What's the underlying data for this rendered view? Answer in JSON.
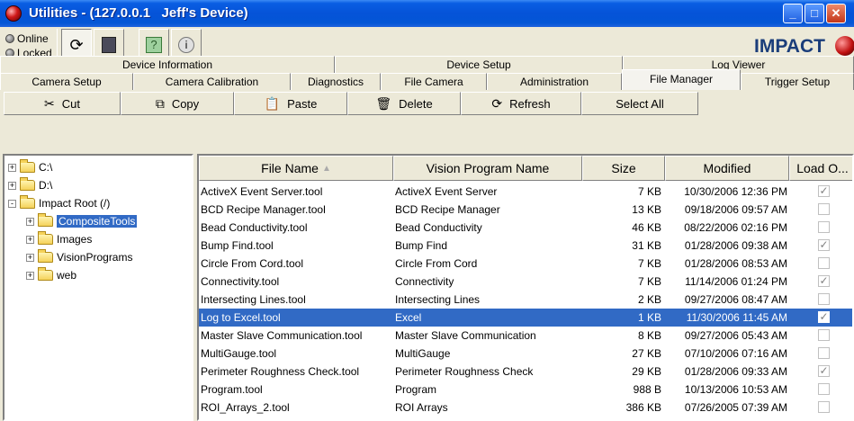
{
  "window": {
    "title": "Utilities - (127.0.0.1   Jeff's Device)",
    "controls": [
      "minimize",
      "maximize",
      "close"
    ]
  },
  "status": {
    "online_label": "Online",
    "locked_label": "Locked"
  },
  "toolbar": {
    "icons": [
      "refresh-sync-icon",
      "device-icon",
      "help-icon",
      "info-icon"
    ],
    "logo_text": "IMPACT"
  },
  "tabs": {
    "back_row": [
      "Device Information",
      "Device Setup",
      "Log Viewer"
    ],
    "front_row": [
      "Camera Setup",
      "Camera Calibration",
      "Diagnostics",
      "File Camera",
      "Administration",
      "File Manager",
      "Trigger Setup"
    ],
    "active": "File Manager"
  },
  "actions": {
    "cut": "Cut",
    "copy": "Copy",
    "paste": "Paste",
    "delete": "Delete",
    "refresh": "Refresh",
    "select_all": "Select All"
  },
  "tree": {
    "items": [
      {
        "label": "C:\\",
        "level": 0,
        "expander": "+"
      },
      {
        "label": "D:\\",
        "level": 0,
        "expander": "+"
      },
      {
        "label": "Impact Root (/)",
        "level": 0,
        "expander": "-"
      },
      {
        "label": "CompositeTools",
        "level": 1,
        "expander": "+",
        "selected": true
      },
      {
        "label": "Images",
        "level": 1,
        "expander": "+"
      },
      {
        "label": "VisionPrograms",
        "level": 1,
        "expander": "+"
      },
      {
        "label": "web",
        "level": 1,
        "expander": "+"
      }
    ]
  },
  "table": {
    "columns": [
      "File Name",
      "Vision Program Name",
      "Size",
      "Modified",
      "Load O..."
    ],
    "sort_column": "File Name",
    "rows": [
      {
        "file": "ActiveX Event Server.tool",
        "program": "ActiveX Event Server",
        "size": "7 KB",
        "modified": "10/30/2006 12:36 PM",
        "load": true
      },
      {
        "file": "BCD Recipe Manager.tool",
        "program": "BCD Recipe Manager",
        "size": "13 KB",
        "modified": "09/18/2006 09:57 AM",
        "load": false
      },
      {
        "file": "Bead Conductivity.tool",
        "program": "Bead Conductivity",
        "size": "46 KB",
        "modified": "08/22/2006 02:16 PM",
        "load": false
      },
      {
        "file": "Bump Find.tool",
        "program": "Bump Find",
        "size": "31 KB",
        "modified": "01/28/2006 09:38 AM",
        "load": true
      },
      {
        "file": "Circle From Cord.tool",
        "program": "Circle From Cord",
        "size": "7 KB",
        "modified": "01/28/2006 08:53 AM",
        "load": false
      },
      {
        "file": "Connectivity.tool",
        "program": "Connectivity",
        "size": "7 KB",
        "modified": "11/14/2006 01:24 PM",
        "load": true
      },
      {
        "file": "Intersecting Lines.tool",
        "program": "Intersecting Lines",
        "size": "2 KB",
        "modified": "09/27/2006 08:47 AM",
        "load": false
      },
      {
        "file": "Log to Excel.tool",
        "program": "Excel",
        "size": "1 KB",
        "modified": "11/30/2006 11:45 AM",
        "load": true,
        "selected": true
      },
      {
        "file": "Master Slave Communication.tool",
        "program": "Master Slave Communication",
        "size": "8 KB",
        "modified": "09/27/2006 05:43 AM",
        "load": false
      },
      {
        "file": "MultiGauge.tool",
        "program": "MultiGauge",
        "size": "27 KB",
        "modified": "07/10/2006 07:16 AM",
        "load": false
      },
      {
        "file": "Perimeter Roughness Check.tool",
        "program": "Perimeter Roughness Check",
        "size": "29 KB",
        "modified": "01/28/2006 09:33 AM",
        "load": true
      },
      {
        "file": "Program.tool",
        "program": "Program",
        "size": "988 B",
        "modified": "10/13/2006 10:53 AM",
        "load": false
      },
      {
        "file": "ROI_Arrays_2.tool",
        "program": "ROI Arrays",
        "size": "386 KB",
        "modified": "07/26/2005 07:39 AM",
        "load": false
      }
    ]
  }
}
